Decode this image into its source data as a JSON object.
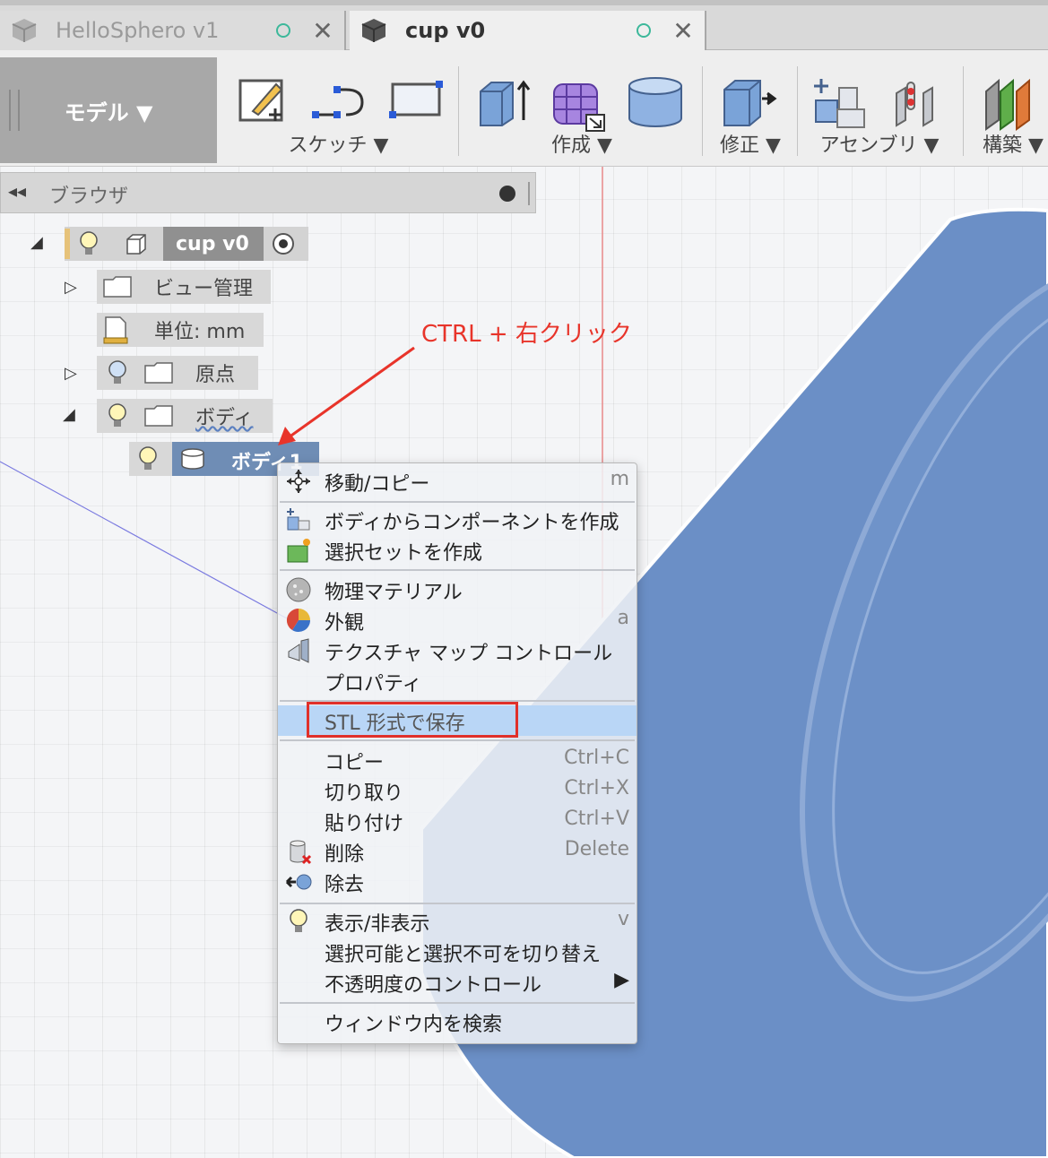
{
  "tabs": [
    {
      "label": "HelloSphero v1",
      "active": false
    },
    {
      "label": "cup v0",
      "active": true
    }
  ],
  "toolbar": {
    "mode": "モデル ▼",
    "groups": [
      {
        "label": "スケッチ ▼"
      },
      {
        "label": "作成 ▼"
      },
      {
        "label": "修正 ▼"
      },
      {
        "label": "アセンブリ ▼"
      },
      {
        "label": "構築 ▼"
      }
    ]
  },
  "browser": {
    "title": "ブラウザ",
    "root": "cup v0",
    "items": [
      {
        "label": "ビュー管理"
      },
      {
        "label": "単位: mm"
      },
      {
        "label": "原点"
      },
      {
        "label": "ボディ"
      },
      {
        "label": "ボディ1"
      }
    ]
  },
  "annotation": {
    "text": "CTRL + 右クリック",
    "color": "#e8342a"
  },
  "context_menu": {
    "items": [
      {
        "label": "移動/コピー",
        "shortcut": "m",
        "icon": "move-icon"
      },
      {
        "label": "ボディからコンポーネントを作成",
        "shortcut": "",
        "icon": "component-icon"
      },
      {
        "label": "選択セットを作成",
        "shortcut": "",
        "icon": "selection-set-icon"
      },
      {
        "label": "物理マテリアル",
        "shortcut": "",
        "icon": "material-icon"
      },
      {
        "label": "外観",
        "shortcut": "a",
        "icon": "appearance-icon"
      },
      {
        "label": "テクスチャ マップ コントロール",
        "shortcut": "",
        "icon": "texture-icon"
      },
      {
        "label": "プロパティ",
        "shortcut": "",
        "icon": ""
      },
      {
        "label": "STL 形式で保存",
        "shortcut": "",
        "icon": "",
        "highlighted": true
      },
      {
        "label": "コピー",
        "shortcut": "Ctrl+C",
        "icon": ""
      },
      {
        "label": "切り取り",
        "shortcut": "Ctrl+X",
        "icon": ""
      },
      {
        "label": "貼り付け",
        "shortcut": "Ctrl+V",
        "icon": ""
      },
      {
        "label": "削除",
        "shortcut": "Delete",
        "icon": "delete-icon"
      },
      {
        "label": "除去",
        "shortcut": "",
        "icon": "remove-icon"
      },
      {
        "label": "表示/非表示",
        "shortcut": "v",
        "icon": "bulb-icon"
      },
      {
        "label": "選択可能と選択不可を切り替え",
        "shortcut": "",
        "icon": ""
      },
      {
        "label": "不透明度のコントロール",
        "shortcut": "▶",
        "icon": ""
      },
      {
        "label": "ウィンドウ内を検索",
        "shortcut": "",
        "icon": ""
      }
    ]
  },
  "colors": {
    "body_blue": "#6b8fc6",
    "highlight": "#b9d6f6",
    "selected_row": "#6f8db5"
  }
}
